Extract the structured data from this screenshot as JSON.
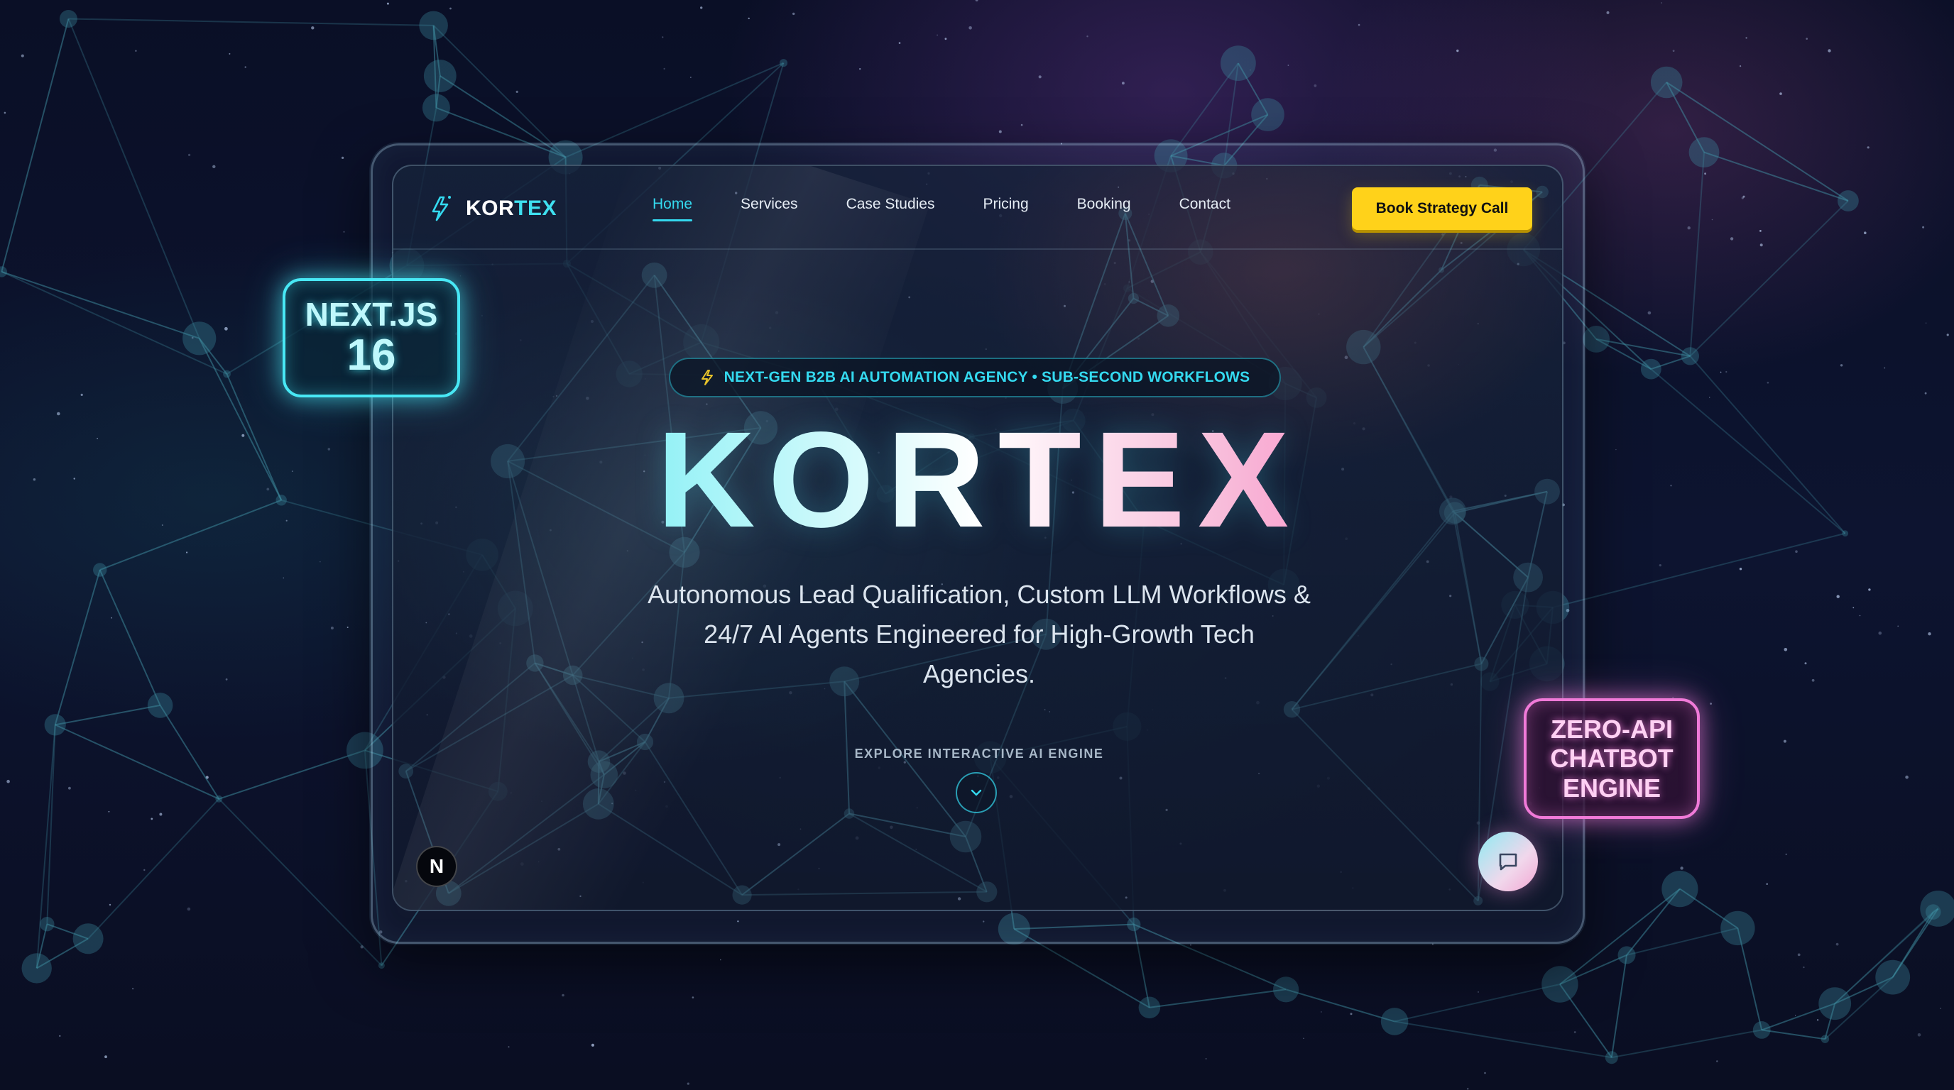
{
  "brand": {
    "name_part1": "KOR",
    "name_part2": "TEX",
    "accent_color": "#34d9ef",
    "logo_icon": "lightning-bolt-icon"
  },
  "nav": {
    "items": [
      {
        "label": "Home",
        "active": true
      },
      {
        "label": "Services"
      },
      {
        "label": "Case Studies"
      },
      {
        "label": "Pricing"
      },
      {
        "label": "Booking"
      },
      {
        "label": "Contact"
      }
    ],
    "cta_label": "Book Strategy Call",
    "cta_color": "#ffd21a"
  },
  "hero": {
    "tagline": "NEXT-GEN B2B AI AUTOMATION AGENCY • SUB-SECOND WORKFLOWS",
    "title": "KORTEX",
    "subtitle_lines": [
      "Autonomous Lead Qualification, Custom LLM Workflows &",
      "24/7 AI Agents Engineered for High-Growth Tech",
      "Agencies."
    ],
    "explore_label": "EXPLORE INTERACTIVE AI ENGINE",
    "explore_icon": "chevron-down-icon"
  },
  "badges": {
    "nextjs": {
      "line1": "NEXT.JS",
      "line2": "16",
      "color": "#48e8f5"
    },
    "chatbot": {
      "lines": [
        "ZERO-API",
        "CHATBOT",
        "ENGINE"
      ],
      "color": "#f07ad8"
    }
  },
  "corner": {
    "n_badge": "N",
    "chat_icon": "chat-bubble-icon"
  }
}
